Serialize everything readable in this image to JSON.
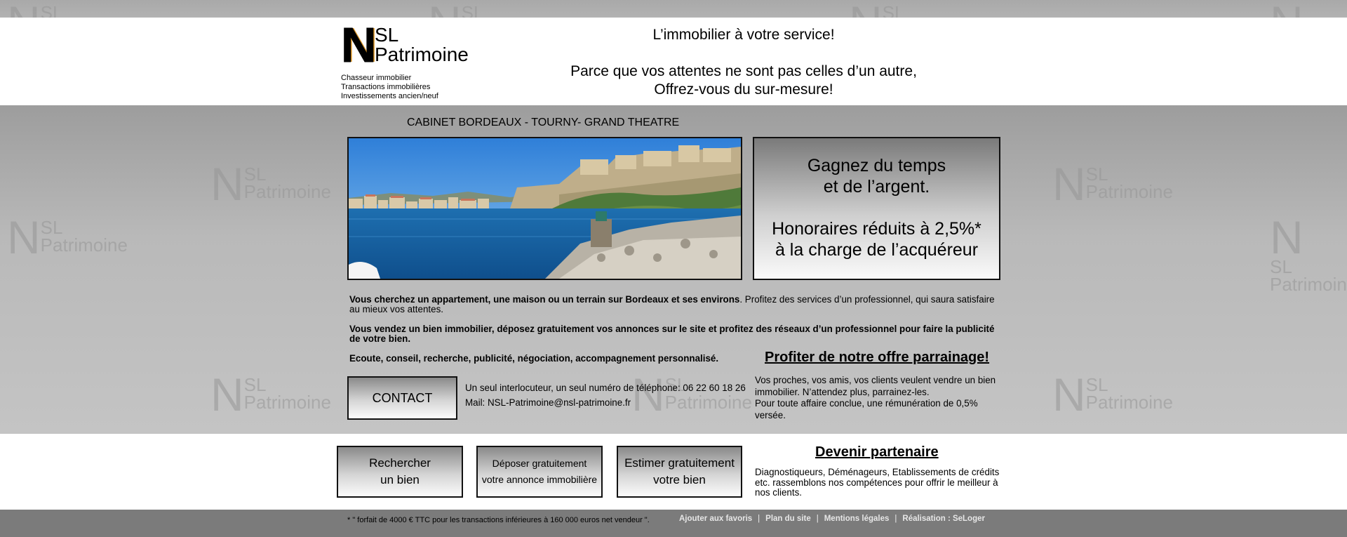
{
  "header": {
    "logo": {
      "n": "N",
      "sl": "SL",
      "patrimoine": "Patrimoine"
    },
    "tagline": [
      "Chasseur immobilier",
      "Transactions immobilières",
      "Investissements ancien/neuf"
    ],
    "headline": "L’immobilier à votre service!",
    "subline_1": "Parce que vos attentes ne sont pas celles d’un autre,",
    "subline_2": "Offrez-vous du sur-mesure!"
  },
  "cabinet": "CABINET BORDEAUX - TOURNY- GRAND THEATRE",
  "promo": {
    "line1": "Gagnez du temps",
    "line2": "et de l’argent.",
    "line3": "Honoraires réduits à 2,5%*",
    "line4": "à la charge de l’acquéreur"
  },
  "intro": {
    "p1_bold": "Vous cherchez un appartement, une maison ou un terrain sur Bordeaux et ses environs",
    "p1_rest": ". Profitez des services d’un professionnel, qui saura satisfaire au mieux vos attentes.",
    "p2_bold": "Vous vendez un bien immobilier, déposez gratuitement vos annonces sur le site et profitez des réseaux d’un professionnel pour faire la publicité de votre bien.",
    "p3_bold": "Ecoute, conseil, recherche, publicité, négociation, accompagnement personnalisé."
  },
  "parrainage": {
    "title": "Profiter de notre offre parrainage!",
    "text_1": "Vos proches, vos amis, vos clients veulent vendre un bien immobilier. N’attendez plus, parrainez-les.",
    "text_2": "Pour toute affaire conclue, une rémunération de 0,5% versée."
  },
  "contact": {
    "button": "CONTACT",
    "phone_line": "Un seul interlocuteur, un seul numéro de téléphone: 06 22 60 18 26",
    "mail_line": "Mail: NSL-Patrimoine@nsl-patrimoine.fr"
  },
  "actions": {
    "search_1": "Rechercher",
    "search_2": "un bien",
    "deposit_1": "Déposer gratuitement",
    "deposit_2": "votre annonce immobilière",
    "estimate_1": "Estimer gratuitement",
    "estimate_2": "votre bien"
  },
  "partenaire": {
    "title": "Devenir partenaire",
    "text": "Diagnostiqueurs, Déménageurs, Etablissements de crédits etc. rassemblons nos compétences pour offrir le meilleur à nos clients."
  },
  "footer": {
    "note": "* \" forfait de 4000 € TTC pour les transactions inférieures à 160 000 euros net vendeur \".",
    "links": [
      "Ajouter aux favoris",
      "Plan du site",
      "Mentions légales",
      "Réalisation : SeLoger"
    ],
    "separator": "|"
  },
  "watermark": {
    "n": "N",
    "sl": "SL",
    "patrimoine": "Patrimoine"
  },
  "colors": {
    "header_bg": "#ffffff",
    "page_bg": "#b4b4b4",
    "footer_bg": "#7b7b7b",
    "logo_accent": "#e09a2a"
  }
}
